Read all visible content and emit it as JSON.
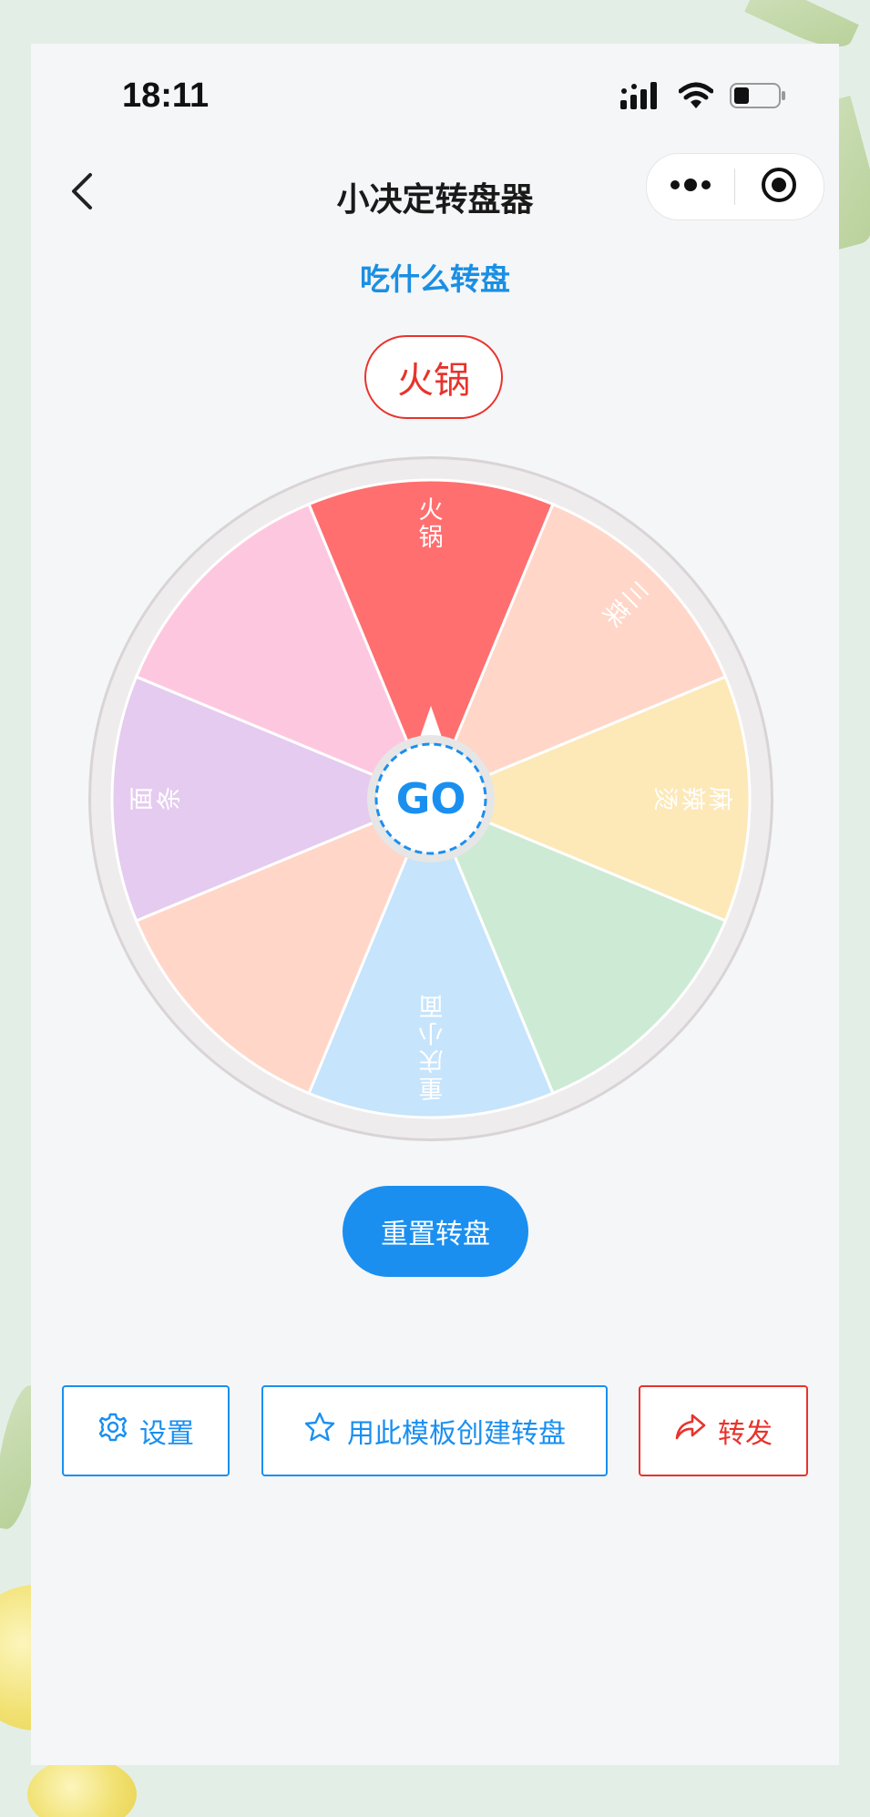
{
  "status_bar": {
    "time": "18:11",
    "icons": [
      "signal-icon",
      "wifi-icon",
      "battery-icon"
    ]
  },
  "nav": {
    "title": "小决定转盘器",
    "back_icon": "chevron-left-icon",
    "more_icon": "more-dots-icon",
    "close_icon": "target-icon"
  },
  "wheel": {
    "title": "吃什么转盘",
    "result": "火锅",
    "go_label": "GO",
    "segments": [
      {
        "label": "火锅",
        "color": "#ff6f6f"
      },
      {
        "label": "三菜",
        "color": "#ffd6c8"
      },
      {
        "label": "麻辣烫",
        "color": "#fde8b8"
      },
      {
        "label": "",
        "color": "#cdebd4"
      },
      {
        "label": "重庆小面",
        "color": "#c6e4fb"
      },
      {
        "label": "",
        "color": "#ffd6c8"
      },
      {
        "label": "面条",
        "color": "#e5cbef"
      },
      {
        "label": "",
        "color": "#fdc8df"
      }
    ]
  },
  "reset_button": "重置转盘",
  "actions": {
    "settings": "设置",
    "create_template": "用此模板创建转盘",
    "share": "转发"
  },
  "colors": {
    "accent_blue": "#1a8ff0",
    "accent_red": "#e8332b",
    "card_bg": "#f5f6f8"
  }
}
